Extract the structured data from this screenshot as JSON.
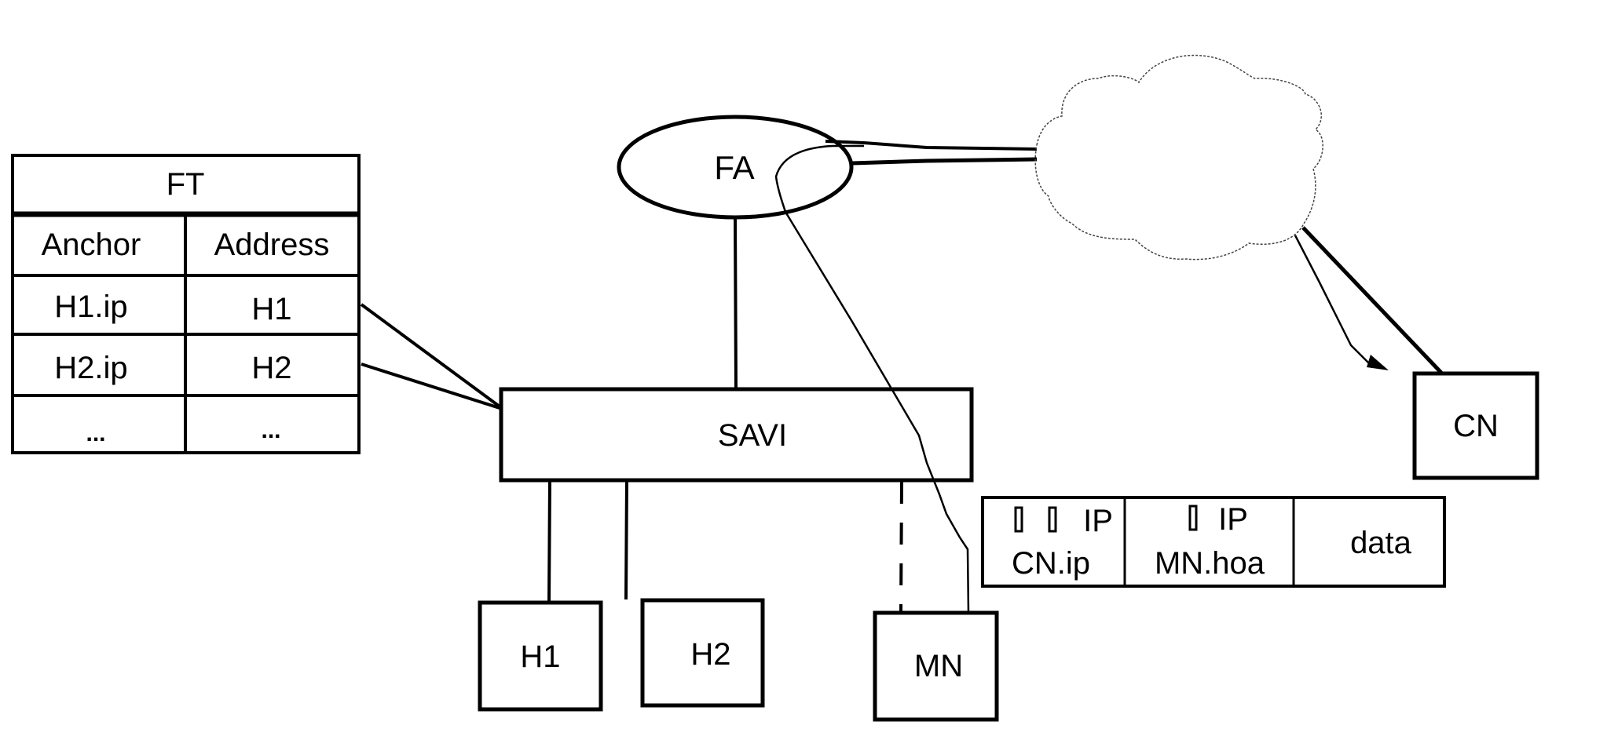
{
  "diagram": {
    "forwarding_table": {
      "title": "FT",
      "columns": [
        "Anchor",
        "Address"
      ],
      "rows": [
        [
          "H1.ip",
          "H1"
        ],
        [
          "H2.ip",
          "H2"
        ],
        [
          "...",
          "..."
        ]
      ]
    },
    "nodes": {
      "fa": "FA",
      "savi": "SAVI",
      "h1": "H1",
      "h2": "H2",
      "mn": "MN",
      "cn": "CN",
      "network": ""
    },
    "packet": {
      "fields": [
        {
          "line1": "IP",
          "line2": "CN.ip",
          "marker_count": 2
        },
        {
          "line1": "IP",
          "line2": "MN.hoa",
          "marker_count": 1
        },
        {
          "line1": "",
          "line2": "data",
          "marker_count": 0
        }
      ]
    },
    "links": [
      {
        "from": "FT.H1",
        "to": "SAVI",
        "style": "solid"
      },
      {
        "from": "FT.H2",
        "to": "SAVI",
        "style": "solid"
      },
      {
        "from": "FA",
        "to": "SAVI",
        "style": "solid"
      },
      {
        "from": "SAVI",
        "to": "H1",
        "style": "solid"
      },
      {
        "from": "SAVI",
        "to": "H2",
        "style": "solid"
      },
      {
        "from": "SAVI",
        "to": "MN",
        "style": "dashed"
      },
      {
        "from": "FA",
        "to": "network",
        "style": "double"
      },
      {
        "from": "network",
        "to": "CN",
        "style": "solid"
      },
      {
        "from": "MN",
        "to": "CN",
        "style": "path-arrow",
        "via": [
          "FA",
          "network"
        ]
      }
    ]
  }
}
